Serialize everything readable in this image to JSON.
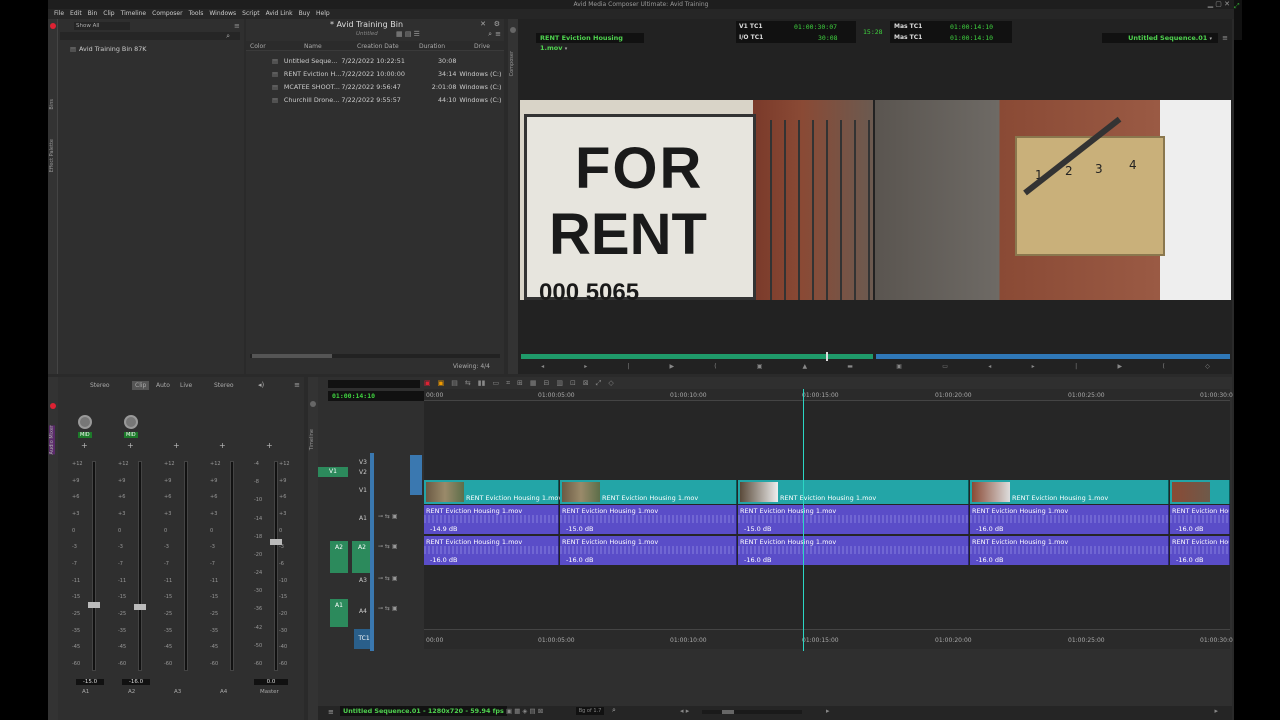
{
  "window_title": "Avid Media Composer Ultimate: Avid Training",
  "menu": [
    "File",
    "Edit",
    "Bin",
    "Clip",
    "Timeline",
    "Composer",
    "Tools",
    "Windows",
    "Script",
    "Avid Link",
    "Buy",
    "Help"
  ],
  "left_panel": {
    "show_all": "Show All",
    "bin_item": "Avid Training Bin 87K"
  },
  "side_tabs": {
    "bins": "Bins",
    "effect_palette": "Effect Palette",
    "composer": "Composer",
    "timeline": "Timeline",
    "audio_mixer": "Audio Mixer"
  },
  "bin": {
    "title": "* Avid Training Bin",
    "view": "Untitled",
    "columns": [
      "Color",
      "Name",
      "Creation Date",
      "Duration",
      "Drive"
    ],
    "rows": [
      {
        "name": "Untitled Seque...",
        "date": "7/22/2022 10:22:51",
        "duration": "30:08",
        "drive": ""
      },
      {
        "name": "RENT Eviction H...",
        "date": "7/22/2022 10:00:00",
        "duration": "34:14",
        "drive": "Windows (C:)"
      },
      {
        "name": "MCATEE SHOOT...",
        "date": "7/22/2022 9:56:47",
        "duration": "2:01:08",
        "drive": "Windows (C:)"
      },
      {
        "name": "Churchill Drone...",
        "date": "7/22/2022 9:55:57",
        "duration": "44:10",
        "drive": "Windows (C:)"
      }
    ],
    "viewing": "Viewing: 4/4"
  },
  "composer": {
    "source_clip": "RENT Eviction Housing 1.mov",
    "record_clip": "Untitled Sequence.01",
    "tc_rows": [
      {
        "label": "V1  TC1",
        "value": "01:00:30:07"
      },
      {
        "label": "I/O  TC1",
        "value": "30:08"
      }
    ],
    "center_tc": "15:28",
    "mas_rows": [
      {
        "label": "Mas  TC1",
        "value": "01:00:14:10"
      },
      {
        "label": "Mas  TC1",
        "value": "01:00:14:10"
      }
    ]
  },
  "mixer": {
    "modes": [
      "Stereo",
      "Clip",
      "Auto",
      "Live",
      "Stereo"
    ],
    "mid": "MID",
    "scale_left": [
      "+12",
      "+9",
      "+6",
      "+3",
      "0",
      "-3",
      "-7",
      "-11",
      "-15",
      "-25",
      "-35",
      "-45",
      "-60"
    ],
    "scale_right": [
      "+12",
      "+9",
      "+6",
      "+3",
      "0",
      "-3",
      "-6",
      "-10",
      "-15",
      "-20",
      "-30",
      "-40",
      "-60"
    ],
    "master_scale": [
      "-4",
      "-8",
      "-10",
      "-14",
      "-18",
      "-20",
      "-24",
      "-30",
      "-36",
      "-42",
      "-50",
      "-60"
    ],
    "channels": [
      {
        "name": "A1",
        "level": "-15.0"
      },
      {
        "name": "A2",
        "level": "-16.0"
      },
      {
        "name": "A3",
        "level": ""
      },
      {
        "name": "A4",
        "level": ""
      },
      {
        "name": "Master",
        "level": "0.0"
      }
    ]
  },
  "timeline": {
    "timecode": "01:00:14:10",
    "ruler": [
      "00:00",
      "01:00:05:00",
      "01:00:10:00",
      "01:00:15:00",
      "01:00:20:00",
      "01:00:25:00",
      "01:00:30:0"
    ],
    "tracks": [
      "V3",
      "V2",
      "V1",
      "A1",
      "A2",
      "A3",
      "A4",
      "TC1"
    ],
    "source_tracks": [
      "V1",
      "A2",
      "A1"
    ],
    "video_clips": [
      "RENT Eviction Housing 1.mov",
      "RENT Eviction Housing 1.mov",
      "RENT Eviction Housing 1.mov",
      "RENT Eviction Housing 1.mov",
      ""
    ],
    "audio_a1": [
      {
        "name": "RENT Eviction Housing 1.mov",
        "level": "-14.9 dB"
      },
      {
        "name": "RENT Eviction Housing 1.mov",
        "level": "-15.0 dB"
      },
      {
        "name": "RENT Eviction Housing 1.mov",
        "level": "-15.0 dB"
      },
      {
        "name": "RENT Eviction Housing 1.mov",
        "level": "-16.0 dB"
      },
      {
        "name": "RENT Eviction Hou",
        "level": "-16.0 dB"
      }
    ],
    "audio_a2": [
      {
        "name": "RENT Eviction Housing 1.mov",
        "level": "-16.0 dB"
      },
      {
        "name": "RENT Eviction Housing 1.mov",
        "level": "-16.0 dB"
      },
      {
        "name": "RENT Eviction Housing 1.mov",
        "level": "-16.0 dB"
      },
      {
        "name": "RENT Eviction Housing 1.mov",
        "level": "-16.0 dB"
      },
      {
        "name": "RENT Eviction Hou",
        "level": "-16.0 dB"
      }
    ],
    "footer": "Untitled Sequence.01 - 1280x720 - 59.94 fps",
    "footer_right": "Bg of 1.7"
  },
  "frame_left": {
    "line1": "FOR",
    "line2": "RENT",
    "phone": "000  5065"
  },
  "frame_right": {
    "box1": "1",
    "box2": "2",
    "box3": "3",
    "box4": "4"
  }
}
